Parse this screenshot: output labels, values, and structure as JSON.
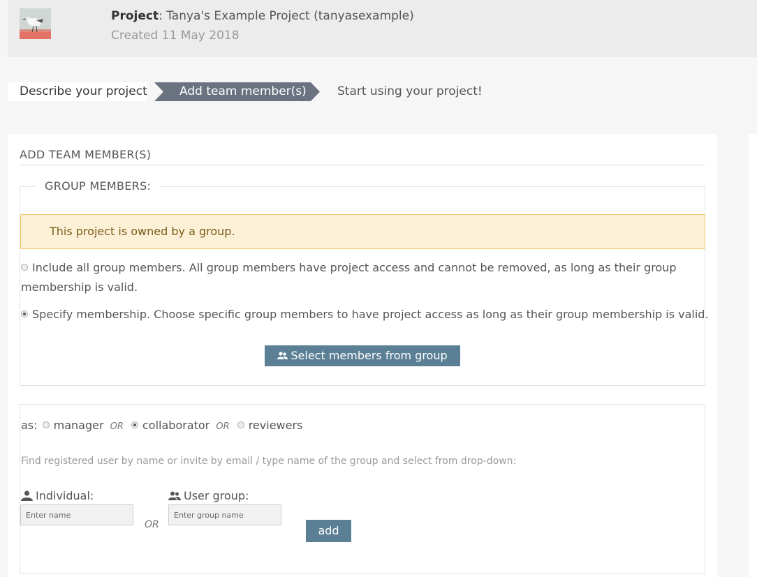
{
  "header": {
    "project_label": "Project",
    "project_name": ": Tanya's Example Project (tanyasexample)",
    "created": "Created 11 May 2018"
  },
  "steps": [
    "Describe your project",
    "Add team member(s)",
    "Start using your project!"
  ],
  "section": {
    "title": "ADD TEAM MEMBER(S)",
    "group_legend": "GROUP MEMBERS:",
    "alert": "This project is owned by a group.",
    "option_all": "Include all group members. All group members have project access and cannot be removed, as long as their group membership is valid.",
    "option_specify": "Specify membership. Choose specific group members to have project access as long as their group membership is valid.",
    "select_button": "Select members from group"
  },
  "roles": {
    "prefix": "as:",
    "manager": "manager",
    "collaborator": "collaborator",
    "reviewers": "reviewers",
    "or": "OR",
    "selected": "collaborator"
  },
  "invite": {
    "hint": "Find registered user by name or invite by email / type name of the group and select from drop-down:",
    "individual_label": "Individual:",
    "individual_placeholder": "Enter name",
    "group_label": "User group:",
    "group_placeholder": "Enter group name",
    "or": "OR",
    "add_button": "add"
  },
  "colors": {
    "accent": "#5b7f95",
    "alert_bg": "#fcf1d6",
    "alert_border": "#f0c868"
  },
  "icons": [
    "user-icon",
    "user-group-icon",
    "avatar-image"
  ]
}
